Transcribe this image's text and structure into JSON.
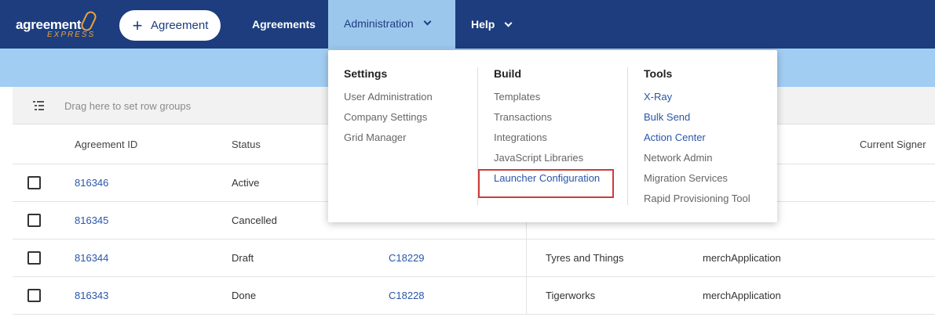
{
  "header": {
    "logo_word": "agreement",
    "logo_sub": "EXPRESS",
    "new_button_label": "Agreement",
    "nav": {
      "agreements": "Agreements",
      "administration": "Administration",
      "help": "Help"
    }
  },
  "group_panel": {
    "placeholder": "Drag here to set row groups"
  },
  "grid": {
    "columns": {
      "agreement_id": "Agreement ID",
      "status": "Status",
      "current_signer": "Current Signer"
    },
    "rows": [
      {
        "id": "816346",
        "status": "Active",
        "ref": "",
        "company": "",
        "app": ""
      },
      {
        "id": "816345",
        "status": "Cancelled",
        "ref": "",
        "company": "",
        "app": ""
      },
      {
        "id": "816344",
        "status": "Draft",
        "ref": "C18229",
        "company": "Tyres and Things",
        "app": "merchApplication"
      },
      {
        "id": "816343",
        "status": "Done",
        "ref": "C18228",
        "company": "Tigerworks",
        "app": "merchApplication"
      }
    ]
  },
  "menu": {
    "settings": {
      "title": "Settings",
      "items": [
        "User Administration",
        "Company Settings",
        "Grid Manager"
      ]
    },
    "build": {
      "title": "Build",
      "items": [
        "Templates",
        "Transactions",
        "Integrations",
        "JavaScript Libraries",
        "Launcher Configuration"
      ]
    },
    "tools": {
      "title": "Tools",
      "items": [
        "X-Ray",
        "Bulk Send",
        "Action Center",
        "Network Admin",
        "Migration Services",
        "Rapid Provisioning Tool"
      ]
    }
  },
  "colors": {
    "nav_bg": "#1d3d7e",
    "nav_active": "#9cc7ed",
    "strip": "#a2cdf2",
    "link": "#2a56a8",
    "highlight": "#d03a3a",
    "logo_accent": "#e9a23b"
  }
}
